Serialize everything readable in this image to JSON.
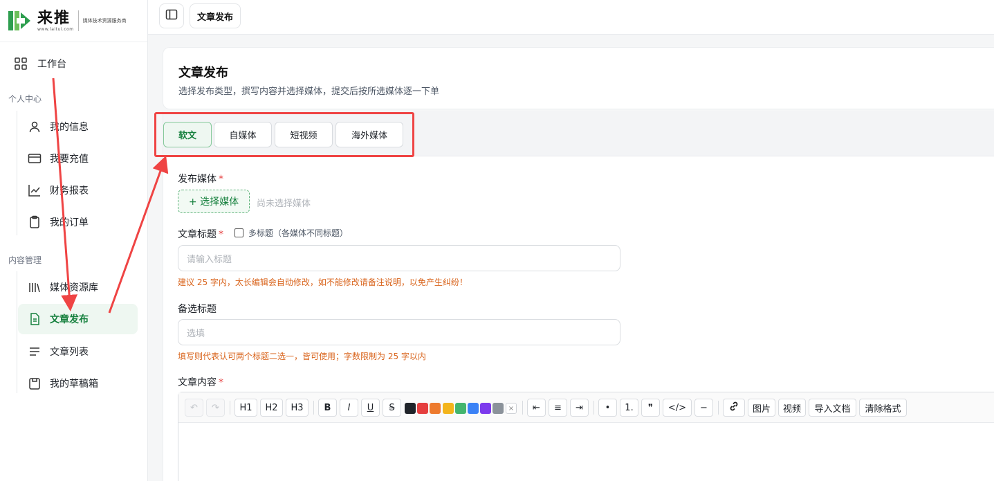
{
  "logo": {
    "brand": "来推",
    "url": "www.laitui.com",
    "tagline": "媒体技术资源服务商"
  },
  "sidebar": {
    "workbench": "工作台",
    "section_personal": "个人中心",
    "personal_items": [
      {
        "label": "我的信息",
        "icon": "user-icon"
      },
      {
        "label": "我要充值",
        "icon": "credit-card-icon"
      },
      {
        "label": "财务报表",
        "icon": "chart-line-icon"
      },
      {
        "label": "我的订单",
        "icon": "clipboard-icon"
      }
    ],
    "section_content": "内容管理",
    "content_items": [
      {
        "label": "媒体资源库",
        "icon": "library-icon"
      },
      {
        "label": "文章发布",
        "icon": "document-icon",
        "active": true
      },
      {
        "label": "文章列表",
        "icon": "list-icon"
      },
      {
        "label": "我的草稿箱",
        "icon": "draft-box-icon"
      }
    ]
  },
  "topbar": {
    "breadcrumb": "文章发布"
  },
  "header": {
    "title": "文章发布",
    "description": "选择发布类型，撰写内容并选择媒体，提交后按所选媒体逐一下单"
  },
  "tabs": [
    {
      "label": "软文",
      "active": true
    },
    {
      "label": "自媒体"
    },
    {
      "label": "短视频"
    },
    {
      "label": "海外媒体"
    }
  ],
  "form": {
    "media_label": "发布媒体",
    "select_media_button": "+ 选择媒体",
    "no_media_hint": "尚未选择媒体",
    "title_label": "文章标题",
    "multi_title_checkbox": "多标题（各媒体不同标题）",
    "title_placeholder": "请输入标题",
    "title_warning": "建议 25 字内，太长编辑会自动修改，如不能修改请备注说明，以免产生纠纷！",
    "alt_title_label": "备选标题",
    "alt_title_placeholder": "选填",
    "alt_title_warning": "填写则代表认可两个标题二选一，皆可使用；字数限制为 25 字以内",
    "content_label": "文章内容",
    "required_mark": "*"
  },
  "editor_toolbar": {
    "undo": "↶",
    "redo": "↷",
    "h1": "H1",
    "h2": "H2",
    "h3": "H3",
    "bold": "B",
    "italic": "I",
    "underline": "U",
    "strike": "S",
    "colors": [
      "#1f2329",
      "#e53e3e",
      "#ed7a2d",
      "#f3b41b",
      "#43b56e",
      "#3b82f6",
      "#7c3aed",
      "#8b929a"
    ],
    "color_clear": "×",
    "align_left": "⇤",
    "align_center": "≡",
    "align_right": "⇥",
    "bullet_list": "•",
    "ordered_list": "1.",
    "quote": "❞",
    "code": "</>",
    "divider": "−",
    "link_icon": "link-icon",
    "image": "图片",
    "video": "视频",
    "import_doc": "导入文档",
    "clear_format": "清除格式"
  },
  "accent_color": "#15803d",
  "annotation_color": "#ef4444"
}
